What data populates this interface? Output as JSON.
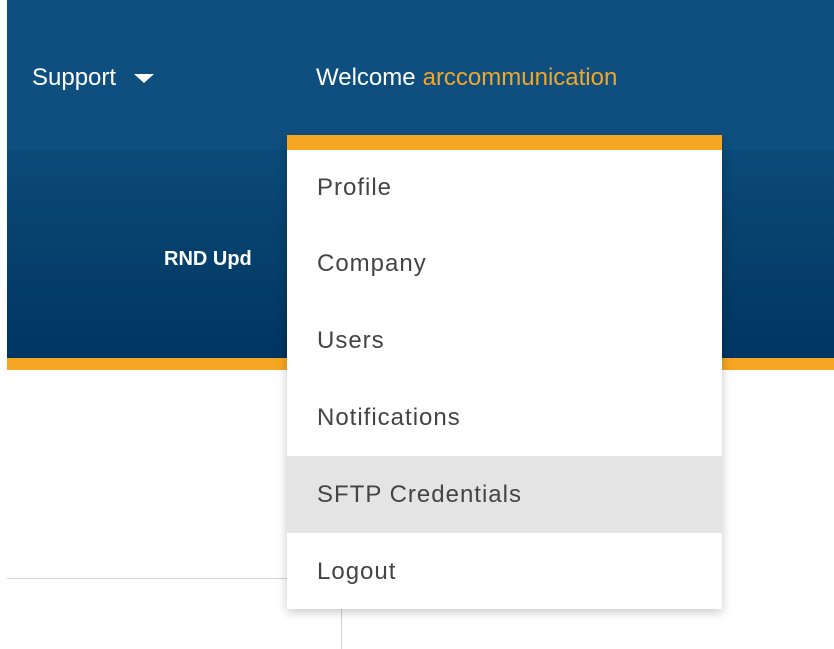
{
  "nav": {
    "support_label": "Support",
    "welcome_prefix": "Welcome",
    "username": "arccommunication"
  },
  "banner": {
    "title": "RND Upd"
  },
  "user_menu": {
    "items": [
      {
        "label": "Profile"
      },
      {
        "label": "Company"
      },
      {
        "label": "Users"
      },
      {
        "label": "Notifications"
      },
      {
        "label": "SFTP Credentials",
        "highlighted": true
      },
      {
        "label": "Logout"
      }
    ]
  },
  "colors": {
    "nav_background": "#0e4f80",
    "accent": "#f5a623",
    "menu_hover": "#e4e4e4",
    "menu_text": "#444444"
  }
}
